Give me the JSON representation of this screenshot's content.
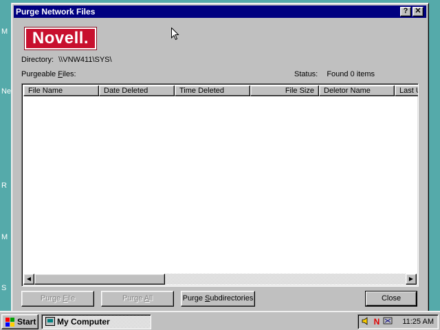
{
  "desktop": {
    "fragments": [
      "M",
      "Ne",
      "R",
      "M",
      "S"
    ]
  },
  "window": {
    "title": "Purge Network Files",
    "help_glyph": "?",
    "close_glyph": "✕",
    "logo_text": "Novell",
    "logo_mark": ".",
    "directory_label": "Directory:",
    "directory_value": "\\\\VNW411\\SYS\\",
    "purgeable_label_pre": "Purgeable ",
    "purgeable_label_mnemonic": "F",
    "purgeable_label_post": "iles:",
    "status_label": "Status:",
    "status_value": "Found 0 items",
    "columns": [
      "File Name",
      "Date Deleted",
      "Time Deleted",
      "File Size",
      "Deletor Name",
      "Last U"
    ],
    "rows": [],
    "buttons": {
      "purge_file_pre": "Purge ",
      "purge_file_mnemonic": "F",
      "purge_file_post": "ile",
      "purge_all_pre": "Purge ",
      "purge_all_mnemonic": "A",
      "purge_all_post": "ll",
      "purge_subdirs_pre": "Purge ",
      "purge_subdirs_mnemonic": "S",
      "purge_subdirs_post": "ubdirectories",
      "close_label": "Close"
    }
  },
  "taskbar": {
    "start_label": "Start",
    "task_label": "My Computer",
    "clock": "11:25 AM",
    "tray_novell": "N"
  },
  "colors": {
    "desktop": "#55aaaa",
    "titlebar": "#000080",
    "face": "#c0c0c0",
    "logo_red": "#c8102e"
  }
}
